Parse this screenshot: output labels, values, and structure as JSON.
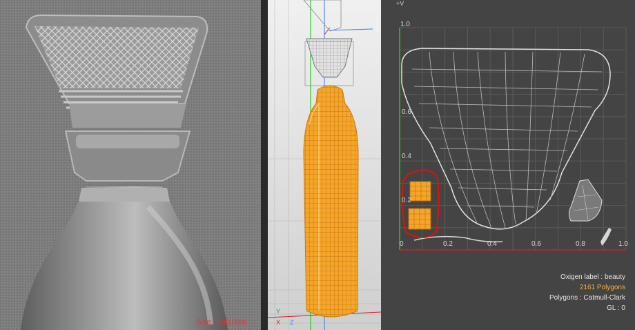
{
  "left_view": {
    "size_readout": "Size : 100.00%"
  },
  "viewport": {
    "axis_labels": {
      "y": "Y",
      "x": "X",
      "z": "Z"
    }
  },
  "uv_editor": {
    "axis_label": "+V",
    "v_ticks": [
      "1.0",
      "0.6",
      "0.4",
      "0.2"
    ],
    "u_ticks": [
      "0",
      "0.2",
      "0.4",
      "0.6",
      "0.8",
      "1.0"
    ],
    "info": {
      "label": "Oxigen label : beauty",
      "polygons": "2161 Polygons",
      "subdivision": "Polygons : Catmull-Clark",
      "gl": "GL : 0"
    },
    "colors": {
      "uv_axis_green": "#22cc22",
      "uv_axis_red": "#cc2222",
      "highlight_orange": "#f0b43a",
      "selection_red": "#e01010"
    }
  }
}
